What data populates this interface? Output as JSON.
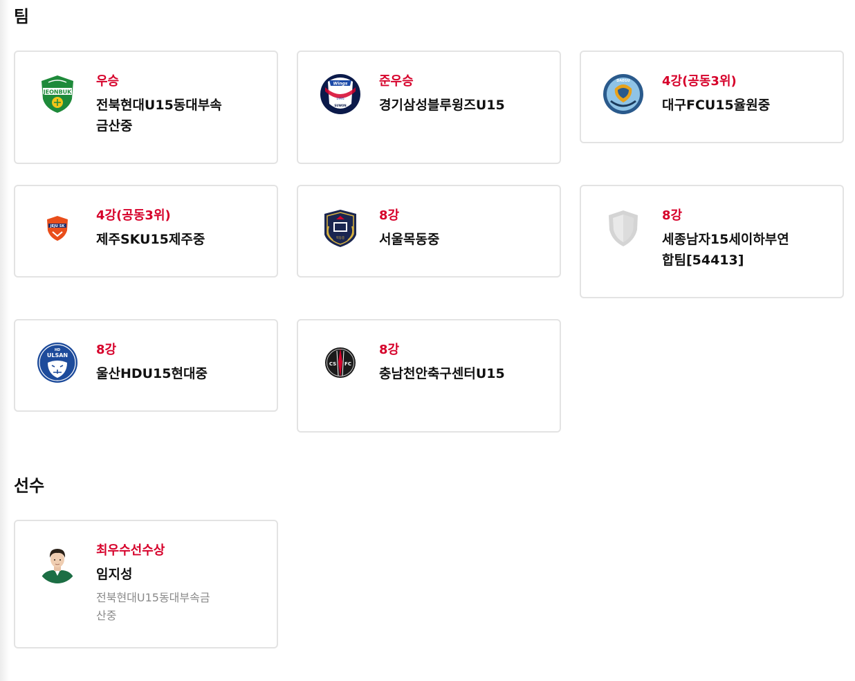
{
  "sections": {
    "team_title": "팀",
    "player_title": "선수"
  },
  "teams": [
    {
      "rank": "우승",
      "name": "전북현대U15동대부속금산중",
      "logo": "jeonbuk-logo-icon"
    },
    {
      "rank": "준우승",
      "name": "경기삼성블루윙즈U15",
      "logo": "suwon-logo-icon"
    },
    {
      "rank": "4강(공동3위)",
      "name": "대구FCU15율원중",
      "logo": "daegu-logo-icon"
    },
    {
      "rank": "4강(공동3위)",
      "name": "제주SKU15제주중",
      "logo": "jeju-logo-icon"
    },
    {
      "rank": "8강",
      "name": "서울목동중",
      "logo": "mokdong-logo-icon"
    },
    {
      "rank": "8강",
      "name": "세종남자15세이하부연합팀[54413]",
      "logo": "default-shield-icon"
    },
    {
      "rank": "8강",
      "name": "울산HDU15현대중",
      "logo": "ulsan-logo-icon"
    },
    {
      "rank": "8강",
      "name": "충남천안축구센터U15",
      "logo": "cheonan-logo-icon"
    }
  ],
  "player": {
    "award": "최우수선수상",
    "name": "임지성",
    "team": "전북현대U15동대부속금산중",
    "photo": "player-photo"
  },
  "colors": {
    "accent": "#d6002a",
    "border": "#e3e3e3",
    "muted_text": "#8a8a8a"
  }
}
